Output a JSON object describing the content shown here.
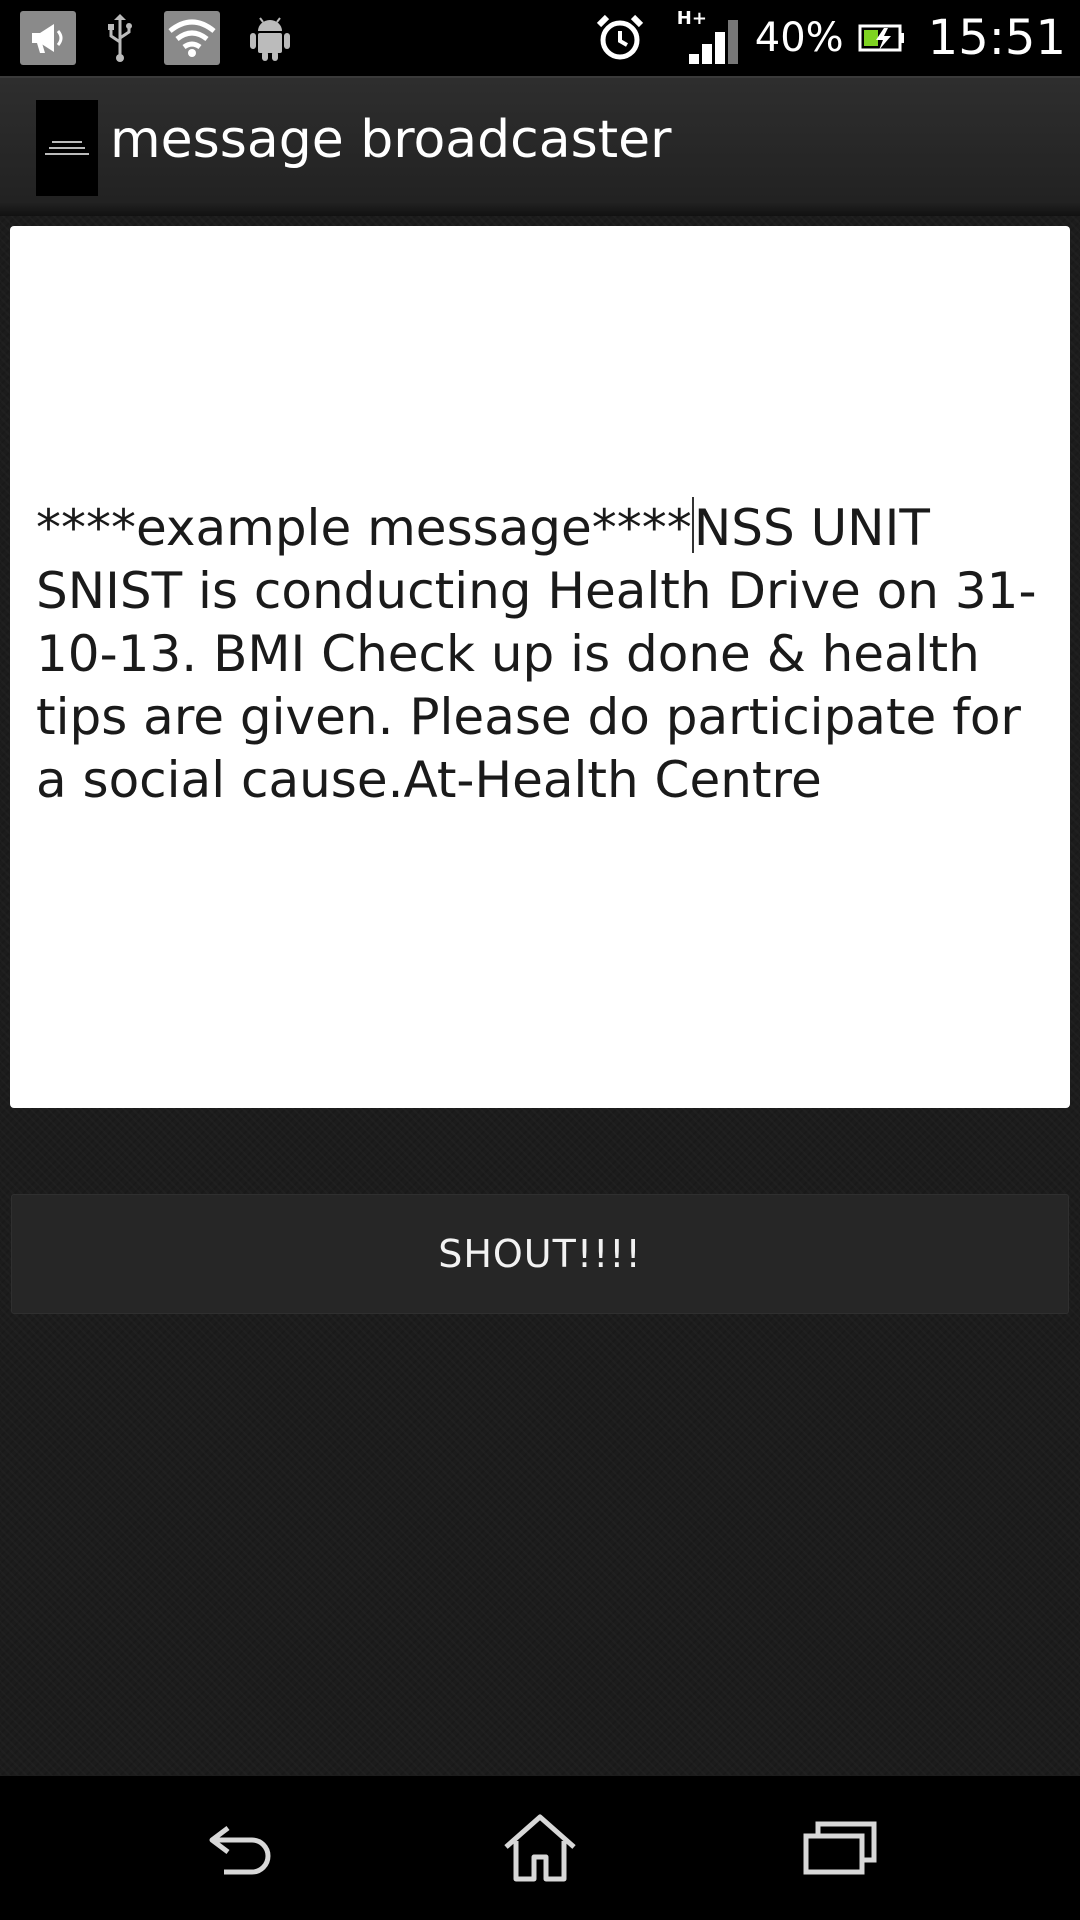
{
  "status_bar": {
    "icons": [
      "megaphone-notification-icon",
      "usb-icon",
      "wifi-icon",
      "android-debug-icon",
      "alarm-icon",
      "hplus-signal-icon",
      "battery-charging-icon"
    ],
    "network_type": "H+",
    "battery_percent": "40%",
    "time": "15:51"
  },
  "action_bar": {
    "title": "message broadcaster",
    "icon": "app-logo-icon"
  },
  "message": {
    "before_cursor": "****example message****",
    "after_cursor": "NSS UNIT SNIST is conducting Health Drive on 31-10-13. BMI Check up is done & health tips are given. Please do participate for a social cause.At-Health Centre"
  },
  "shout_button": {
    "label": "SHOUT!!!!"
  },
  "nav_bar": {
    "icons": [
      "back-icon",
      "home-icon",
      "recent-apps-icon"
    ]
  },
  "colors": {
    "background": "#1c1c1c",
    "status_bar": "#000000",
    "text_field": "#ffffff",
    "button": "#262626"
  }
}
